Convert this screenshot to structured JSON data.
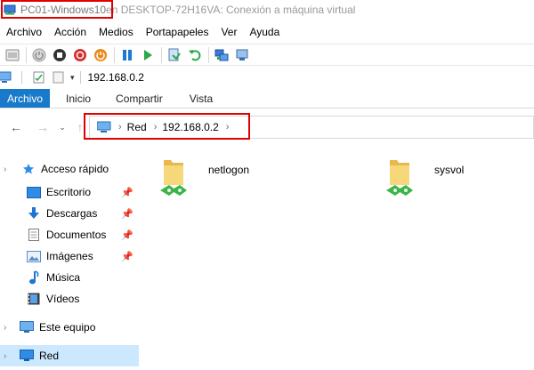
{
  "window": {
    "vm_name": "PC01-Windows10",
    "title_rest": " en DESKTOP-72H16VA: Conexión a máquina virtual"
  },
  "vm_menu": [
    "Archivo",
    "Acción",
    "Medios",
    "Portapapeles",
    "Ver",
    "Ayuda"
  ],
  "quick_access": {
    "path_title": "192.168.0.2"
  },
  "ribbon": {
    "tabs": [
      "Archivo",
      "Inicio",
      "Compartir",
      "Vista"
    ],
    "active": "Archivo"
  },
  "address": {
    "crumbs": [
      "Red",
      "192.168.0.2"
    ]
  },
  "nav": {
    "quick_access_label": "Acceso rápido",
    "items": [
      {
        "label": "Escritorio",
        "icon": "desktop-icon",
        "pinned": true
      },
      {
        "label": "Descargas",
        "icon": "download-icon",
        "pinned": true
      },
      {
        "label": "Documentos",
        "icon": "documents-icon",
        "pinned": true
      },
      {
        "label": "Imágenes",
        "icon": "pictures-icon",
        "pinned": true
      },
      {
        "label": "Música",
        "icon": "music-icon",
        "pinned": false
      },
      {
        "label": "Vídeos",
        "icon": "videos-icon",
        "pinned": false
      }
    ],
    "this_pc": "Este equipo",
    "network": "Red"
  },
  "shares": [
    {
      "name": "netlogon",
      "icon": "shared-folder-icon"
    },
    {
      "name": "sysvol",
      "icon": "shared-folder-icon"
    }
  ],
  "colors": {
    "accent": "#1979ca",
    "highlight": "#e00000",
    "selection": "#cce8ff"
  }
}
